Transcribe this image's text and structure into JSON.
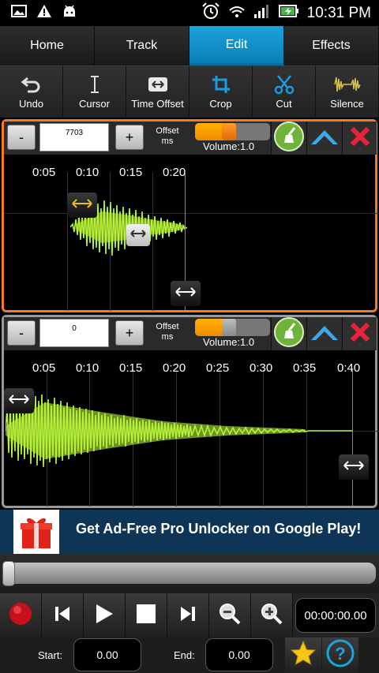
{
  "status_bar": {
    "time": "10:31 PM",
    "left_icons": [
      "gallery-icon",
      "warning-icon",
      "android-icon"
    ],
    "right_icons": [
      "alarm-icon",
      "wifi-icon",
      "signal-icon",
      "battery-charging-icon"
    ]
  },
  "tabs": [
    {
      "label": "Home",
      "active": false
    },
    {
      "label": "Track",
      "active": false
    },
    {
      "label": "Edit",
      "active": true
    },
    {
      "label": "Effects",
      "active": false
    }
  ],
  "tools": [
    {
      "label": "Undo",
      "icon": "undo-icon"
    },
    {
      "label": "Cursor",
      "icon": "cursor-icon"
    },
    {
      "label": "Time Offset",
      "icon": "time-offset-icon"
    },
    {
      "label": "Crop",
      "icon": "crop-icon"
    },
    {
      "label": "Cut",
      "icon": "scissors-icon"
    },
    {
      "label": "Silence",
      "icon": "silence-icon"
    }
  ],
  "tracks": [
    {
      "minus": "-",
      "offset_value": "7703",
      "plus": "+",
      "offset_label_1": "Offset",
      "offset_label_2": "ms",
      "volume_text": "Volume:1.0",
      "volume_level": 0.45,
      "selected": true,
      "ticks": [
        "0:05",
        "0:10",
        "0:15",
        "0:20"
      ]
    },
    {
      "minus": "-",
      "offset_value": "0",
      "plus": "+",
      "offset_label_1": "Offset",
      "offset_label_2": "ms",
      "volume_text": "Volume:1.0",
      "volume_level": 0.45,
      "selected": false,
      "ticks": [
        "0:05",
        "0:10",
        "0:15",
        "0:20",
        "0:25",
        "0:30",
        "0:35",
        "0:40"
      ]
    }
  ],
  "ad": {
    "text": "Get Ad-Free Pro Unlocker on Google Play!",
    "icon": "gift-icon"
  },
  "seek": {
    "position": 0.0
  },
  "transport": {
    "buttons": [
      "record-icon",
      "skip-back-icon",
      "play-icon",
      "stop-icon",
      "skip-forward-icon",
      "zoom-out-icon",
      "zoom-in-icon"
    ],
    "time": "00:00:00.00"
  },
  "bottom": {
    "start_label": "Start:",
    "start_value": "0.00",
    "end_label": "End:",
    "end_value": "0.00"
  },
  "colors": {
    "accent": "#1aa4dc",
    "selected_border": "#f07c2a",
    "waveform": "#b6f23a",
    "volume": "#f59a00"
  }
}
